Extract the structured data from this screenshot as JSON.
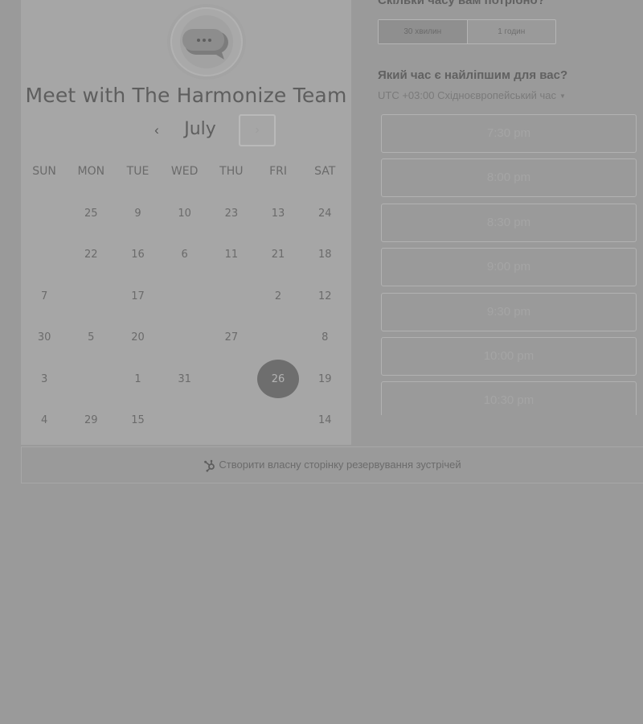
{
  "calendar": {
    "title": "Meet with The Harmonize Team",
    "month": "July",
    "prev_icon": "chevron-left-icon",
    "next_icon": "chevron-right-icon",
    "weekdays": [
      "SUN",
      "MON",
      "TUE",
      "WED",
      "THU",
      "FRI",
      "SAT"
    ],
    "weeks": [
      [
        "",
        "25",
        "9",
        "10",
        "23",
        "13",
        "24"
      ],
      [
        "",
        "22",
        "16",
        "6",
        "11",
        "21",
        "18"
      ],
      [
        "7",
        "",
        "17",
        "",
        "",
        "2",
        "12"
      ],
      [
        "30",
        "5",
        "20",
        "",
        "27",
        "",
        "8"
      ],
      [
        "3",
        "",
        "1",
        "31",
        "",
        "26",
        "19"
      ],
      [
        "4",
        "29",
        "15",
        "",
        "",
        "",
        "14"
      ]
    ],
    "selected_day": "26"
  },
  "scheduler": {
    "duration_heading": "Скільки часу вам потрібно?",
    "durations": [
      {
        "label": "30 хвилин",
        "active": true
      },
      {
        "label": "1 годин",
        "active": false
      }
    ],
    "time_heading": "Який час є найліпшим для вас?",
    "timezone": "UTC +03:00 Східноєвропейський час",
    "slots": [
      "7:30 pm",
      "8:00 pm",
      "8:30 pm",
      "9:00 pm",
      "9:30 pm",
      "10:00 pm",
      "10:30 pm"
    ]
  },
  "footer": {
    "link_label": "Створити власну сторінку резервування зустрічей",
    "icon": "hubspot-sprocket-icon"
  },
  "colors": {
    "overlay_background": "#9a9a9a",
    "panel_background": "#a6a6a6",
    "selected_day": "#6e6e6e"
  }
}
